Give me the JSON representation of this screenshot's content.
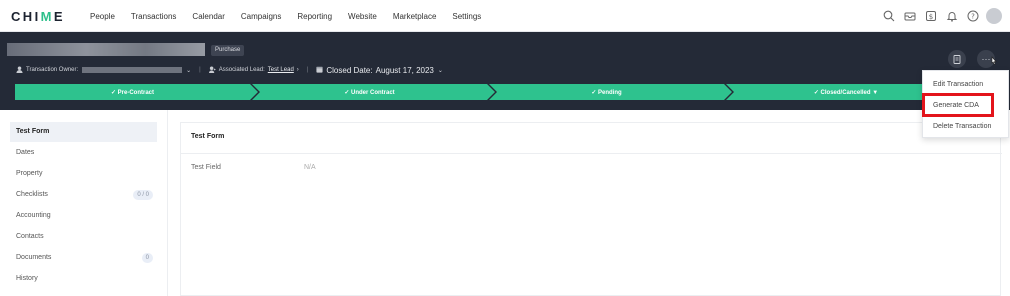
{
  "brand": {
    "name_start": "CHI",
    "name_accent": "M",
    "name_end": "E"
  },
  "nav": [
    "People",
    "Transactions",
    "Calendar",
    "Campaigns",
    "Reporting",
    "Website",
    "Marketplace",
    "Settings"
  ],
  "nav_icons": [
    "search-icon",
    "inbox-icon",
    "dollar-icon",
    "bell-icon",
    "help-icon"
  ],
  "header": {
    "badge": "Purchase",
    "owner_label": "Transaction Owner:",
    "lead_label": "Associated Lead:",
    "lead_value": "Test Lead",
    "closed_label": "Closed Date:",
    "closed_value": "August 17, 2023"
  },
  "pipeline": [
    {
      "label": "✓ Pre-Contract"
    },
    {
      "label": "✓ Under Contract"
    },
    {
      "label": "✓ Pending"
    },
    {
      "label": "✓ Closed/Cancelled ▼"
    }
  ],
  "menu": [
    "Edit Transaction",
    "Generate CDA",
    "Delete Transaction"
  ],
  "sidebar": [
    {
      "label": "Test Form"
    },
    {
      "label": "Dates"
    },
    {
      "label": "Property"
    },
    {
      "label": "Checklists",
      "count": "0 / 0"
    },
    {
      "label": "Accounting"
    },
    {
      "label": "Contacts"
    },
    {
      "label": "Documents",
      "count": "0"
    },
    {
      "label": "History"
    }
  ],
  "form": {
    "title": "Test Form",
    "field_label": "Test Field",
    "field_value": "N/A"
  },
  "colors": {
    "accent": "#2ec28e",
    "header_bg": "#242a37",
    "highlight": "#e3141b"
  }
}
